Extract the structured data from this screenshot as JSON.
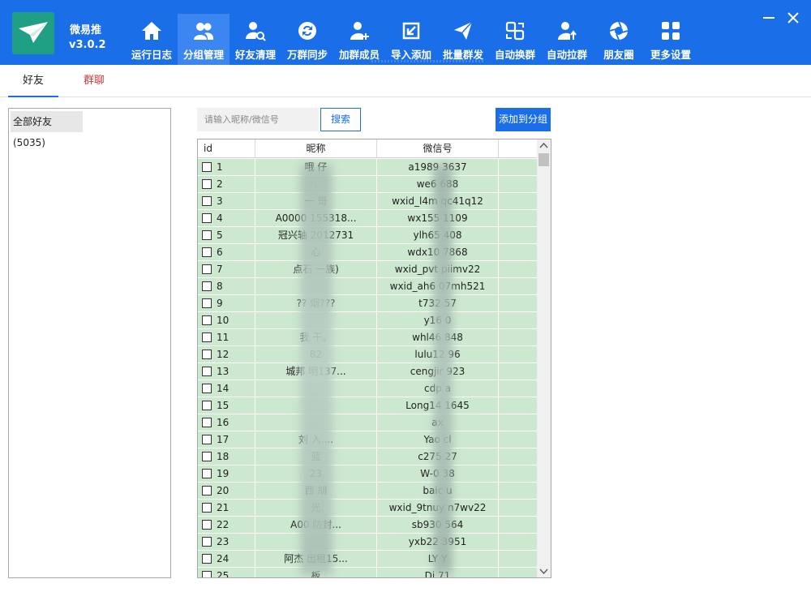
{
  "app": {
    "name": "微易推",
    "version": "v3.0.2"
  },
  "nav": [
    {
      "label": "运行日志",
      "icon": "home-icon"
    },
    {
      "label": "分组管理",
      "icon": "group-users-icon",
      "active": true
    },
    {
      "label": "好友清理",
      "icon": "user-search-icon"
    },
    {
      "label": "万群同步",
      "icon": "sync-icon"
    },
    {
      "label": "加群成员",
      "icon": "user-add-icon"
    },
    {
      "label": "导入添加",
      "icon": "import-icon"
    },
    {
      "label": "批量群发",
      "icon": "send-icon"
    },
    {
      "label": "自动换群",
      "icon": "swap-icon"
    },
    {
      "label": "自动拉群",
      "icon": "user-up-icon"
    },
    {
      "label": "朋友圈",
      "icon": "aperture-icon"
    },
    {
      "label": "更多设置",
      "icon": "grid-icon"
    }
  ],
  "tabs": {
    "friends": "好友",
    "groups": "群聊"
  },
  "group_panel": {
    "all_friends": "全部好友(5035)"
  },
  "search": {
    "placeholder": "请输入昵称/微信号",
    "button": "搜索"
  },
  "add_to_group": "添加到分组",
  "table": {
    "columns": {
      "id": "id",
      "nickname": "昵称",
      "wxid": "微信号"
    },
    "rows": [
      {
        "id": "1",
        "nickname": "哦      仔",
        "wxid": "a1989      3637"
      },
      {
        "id": "2",
        "nickname": ".",
        "wxid": "we6      688"
      },
      {
        "id": "3",
        "nickname": "一      哥",
        "wxid": "wxid_l4m      qc41q12"
      },
      {
        "id": "4",
        "nickname": "A0000      155318...",
        "wxid": "wx155      1109"
      },
      {
        "id": "5",
        "nickname": "冠兴轴      2012731",
        "wxid": "ylh65      408"
      },
      {
        "id": "6",
        "nickname": "      心",
        "wxid": "wdx10      7868"
      },
      {
        "id": "7",
        "nickname": "点石      一族)",
        "wxid": "wxid_pvt      piimv22"
      },
      {
        "id": "8",
        "nickname": "",
        "wxid": "wxid_ah6      07mh521"
      },
      {
        "id": "9",
        "nickname": "??      烟???",
        "wxid": "t732      57"
      },
      {
        "id": "10",
        "nickname": "",
        "wxid": "y16      0"
      },
      {
        "id": "11",
        "nickname": "我      干。",
        "wxid": "whl46      848"
      },
      {
        "id": "12",
        "nickname": "      82",
        "wxid": "lulu12      96"
      },
      {
        "id": "13",
        "nickname": "城邦      明137...",
        "wxid": "cengjir      923"
      },
      {
        "id": "14",
        "nickname": "      ",
        "wxid": "cdp      a"
      },
      {
        "id": "15",
        "nickname": "",
        "wxid": "Long14      1645"
      },
      {
        "id": "16",
        "nickname": "",
        "wxid": "ax"
      },
      {
        "id": "17",
        "nickname": "刘      入....",
        "wxid": "Yao      cl"
      },
      {
        "id": "18",
        "nickname": "      蓝",
        "wxid": "c275      27"
      },
      {
        "id": "19",
        "nickname": "      23",
        "wxid": "W-0      38"
      },
      {
        "id": "20",
        "nickname": "西      胡",
        "wxid": "baic      u"
      },
      {
        "id": "21",
        "nickname": "      光",
        "wxid": "wxid_9tnuy      n7wv22"
      },
      {
        "id": "22",
        "nickname": "A00      防封...",
        "wxid": "sb930      564"
      },
      {
        "id": "23",
        "nickname": "",
        "wxid": "yxb22      3951"
      },
      {
        "id": "24",
        "nickname": "阿杰      出租15...",
        "wxid": "LY      Y"
      },
      {
        "id": "25",
        "nickname": "      板",
        "wxid": "Di      71"
      }
    ]
  },
  "colors": {
    "header": "#1a6ee8",
    "nav_active": "#3b86f0",
    "row": "#cce8cf",
    "logo": "#1fa085",
    "group_tab": "#d23b3b"
  }
}
